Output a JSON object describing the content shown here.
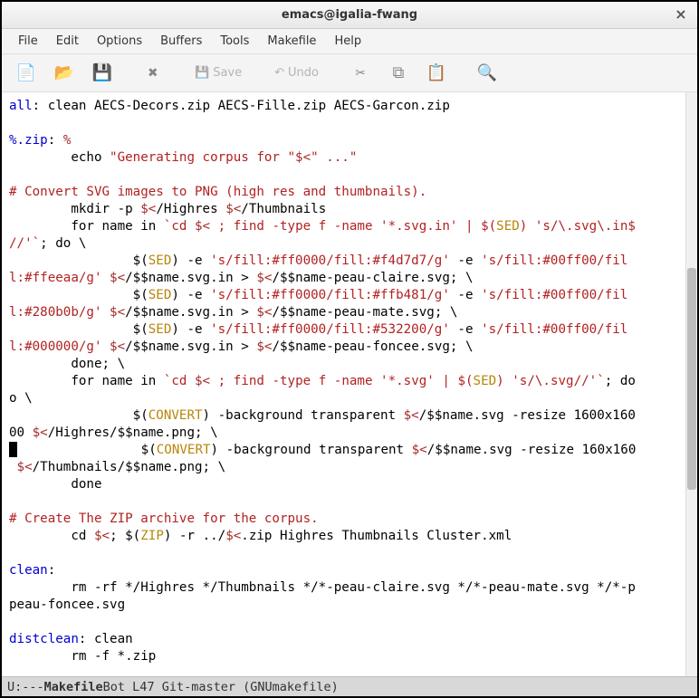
{
  "window": {
    "title": "emacs@igalia-fwang"
  },
  "menu": {
    "file": "File",
    "edit": "Edit",
    "options": "Options",
    "buffers": "Buffers",
    "tools": "Tools",
    "makefile": "Makefile",
    "help": "Help"
  },
  "toolbar": {
    "save_label": "Save",
    "undo_label": "Undo"
  },
  "code": {
    "l1a": "all",
    "l1b": ": clean AECS-Decors.zip AECS-Fille.zip AECS-Garcon.zip",
    "l3a": "%.zip",
    "l3b": ": ",
    "l3c": "%",
    "l4a": "        echo ",
    "l4b": "\"Generating corpus for \"",
    "l4c": "$<",
    "l4d": "\" ...\"",
    "l6": "# Convert SVG images to PNG (high res and thumbnails).",
    "l7a": "        mkdir -p ",
    "l7b": "$<",
    "l7c": "/Highres ",
    "l7d": "$<",
    "l7e": "/Thumbnails",
    "l8a": "        for name in ",
    "l8b": "`cd ",
    "l8c": "$<",
    "l8d": " ; find -type f -name '*.svg.in' | $(",
    "l8e": "SED",
    "l8f": ") 's/\\.svg\\.in",
    "l8g": "$",
    "l9a": "//'`",
    "l9b": "; do \\",
    "l10a": "                $(",
    "l10b": "SED",
    "l10c": ") -e ",
    "l10d": "'s/fill:#ff0000/fill:#f4d7d7/g'",
    "l10e": " -e ",
    "l10f": "'s/fill:#00ff00/fil",
    "l11a": "l:#ffeeaa/g'",
    "l11b": " ",
    "l11c": "$<",
    "l11d": "/$$name.svg.in > ",
    "l11e": "$<",
    "l11f": "/$$name-peau-claire.svg; \\",
    "l12a": "                $(",
    "l12b": "SED",
    "l12c": ") -e ",
    "l12d": "'s/fill:#ff0000/fill:#ffb481/g'",
    "l12e": " -e ",
    "l12f": "'s/fill:#00ff00/fil",
    "l13a": "l:#280b0b/g'",
    "l13b": " ",
    "l13c": "$<",
    "l13d": "/$$name.svg.in > ",
    "l13e": "$<",
    "l13f": "/$$name-peau-mate.svg; \\",
    "l14a": "                $(",
    "l14b": "SED",
    "l14c": ") -e ",
    "l14d": "'s/fill:#ff0000/fill:#532200/g'",
    "l14e": " -e ",
    "l14f": "'s/fill:#00ff00/fil",
    "l15a": "l:#000000/g'",
    "l15b": " ",
    "l15c": "$<",
    "l15d": "/$$name.svg.in > ",
    "l15e": "$<",
    "l15f": "/$$name-peau-foncee.svg; \\",
    "l16": "        done; \\",
    "l17a": "        for name in ",
    "l17b": "`cd ",
    "l17c": "$<",
    "l17d": " ; find -type f -name '*.svg' | $(",
    "l17e": "SED",
    "l17f": ") 's/\\.svg//'`",
    "l17g": "; d",
    "l17h": "o",
    "l18": "o \\",
    "l19a": "                $(",
    "l19b": "CONVERT",
    "l19c": ") -background transparent ",
    "l19d": "$<",
    "l19e": "/$$name.svg -resize 1600x16",
    "l19f": "0",
    "l20a": "00 ",
    "l20b": "$<",
    "l20c": "/Highres/$$name.png; \\",
    "l21a": "                $(",
    "l21b": "CONVERT",
    "l21c": ") -background transparent ",
    "l21d": "$<",
    "l21e": "/$$name.svg -resize 160x160",
    "l21f": "",
    "l22a": " ",
    "l22b": "$<",
    "l22c": "/Thumbnails/$$name.png; \\",
    "l23": "        done",
    "l25": "# Create The ZIP archive for the corpus.",
    "l26a": "        cd ",
    "l26b": "$<",
    "l26c": "; $(",
    "l26d": "ZIP",
    "l26e": ") -r ../",
    "l26f": "$<",
    "l26g": ".zip Highres Thumbnails Cluster.xml",
    "l28a": "clean",
    "l28b": ":",
    "l29a": "        rm -rf */Highres */Thumbnails */*-peau-claire.svg */*-peau-mate.svg */*-",
    "l29b": "p",
    "l30": "peau-foncee.svg",
    "l32a": "distclean",
    "l32b": ": clean",
    "l33": "        rm -f *.zip"
  },
  "modeline": {
    "prefix": "U:--- ",
    "bufname": " Makefile ",
    "rest": "     Bot L47   Git-master  (GNUmakefile)"
  }
}
